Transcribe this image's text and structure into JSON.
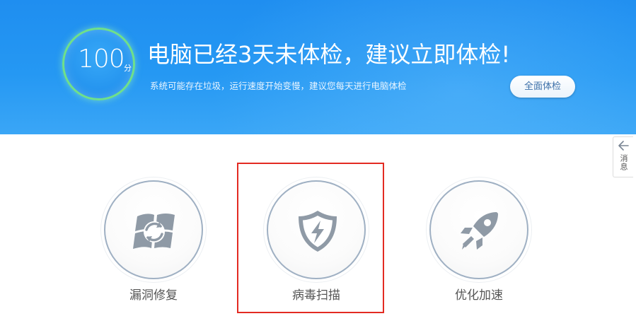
{
  "banner": {
    "score": "100",
    "score_unit": "分",
    "headline": "电脑已经3天未体检，建议立即体检!",
    "subline": "系统可能存在垃圾，运行速度开始变慢，建议您每天进行电脑体检",
    "check_button": "全面体检",
    "ring_color": "#6fe08a",
    "bg_color": "#1f8ef0"
  },
  "side_tab": {
    "label": "消息",
    "icon": "arrow-left-icon"
  },
  "tools": [
    {
      "label": "漏洞修复",
      "icon": "windows-repair-icon"
    },
    {
      "label": "病毒扫描",
      "icon": "shield-lightning-icon",
      "highlighted": true
    },
    {
      "label": "优化加速",
      "icon": "rocket-icon"
    }
  ],
  "colors": {
    "icon_gray": "#8f9aa6",
    "highlight_red": "#e32b22",
    "label_gray": "#555555"
  }
}
